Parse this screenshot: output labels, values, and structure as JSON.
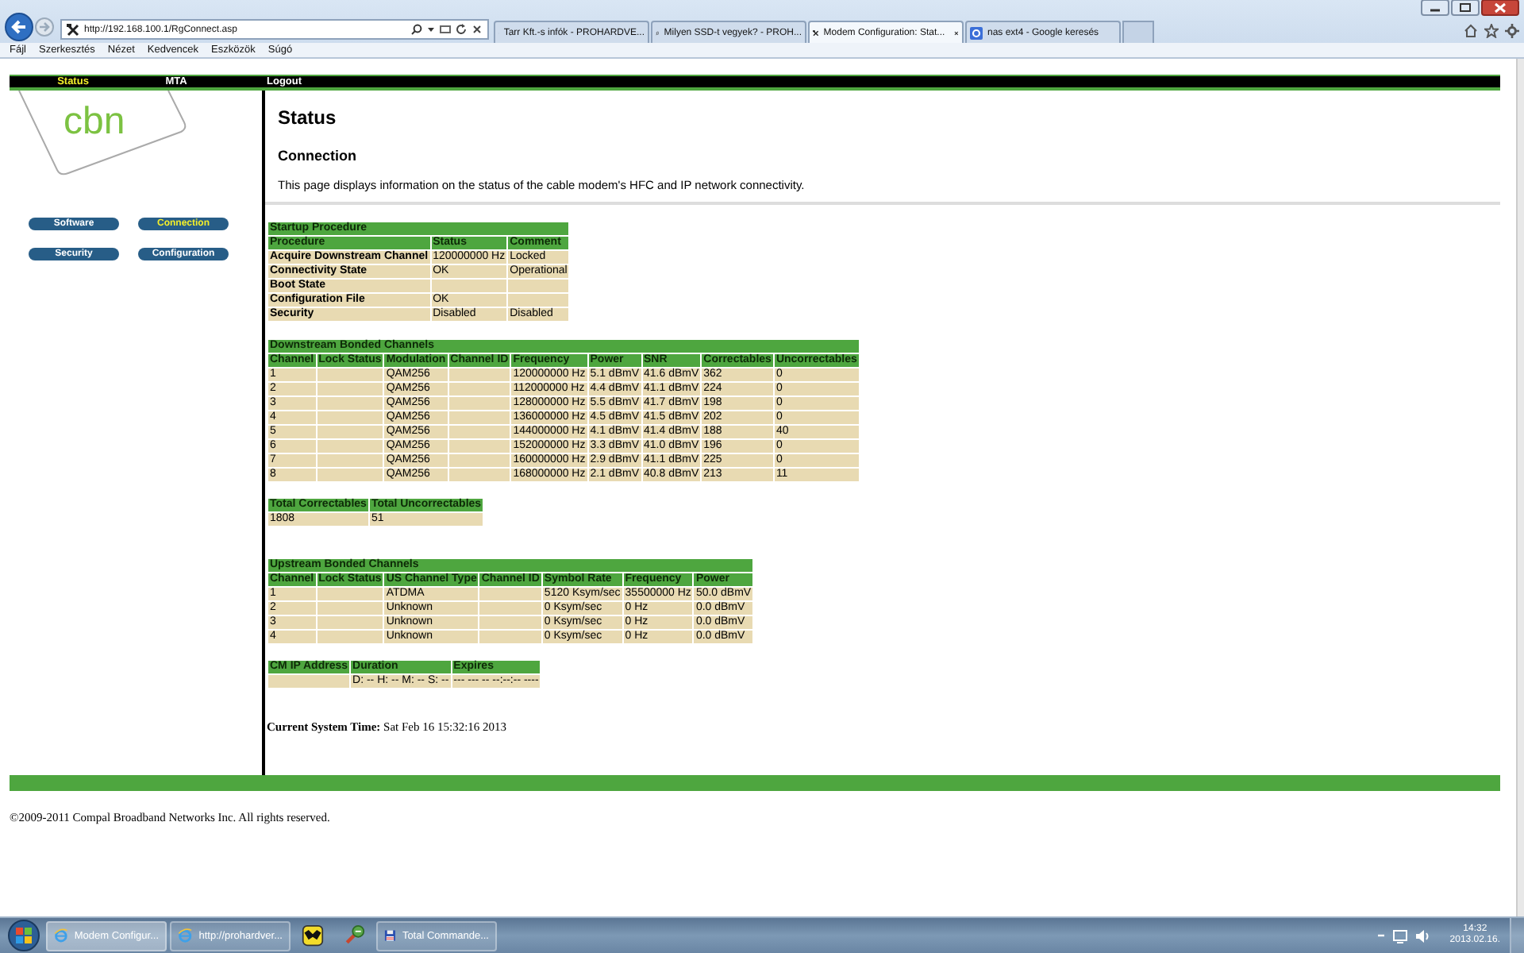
{
  "browser": {
    "address": "http://192.168.100.1/RgConnect.asp",
    "tabs": [
      {
        "label": "Tarr Kft.-s infók - PROHARDVE...",
        "kind": "site",
        "selected": false
      },
      {
        "label": "Milyen SSD-t vegyek? - PROH...",
        "kind": "site",
        "selected": false
      },
      {
        "label": "Modem Configuration: Stat...",
        "kind": "tools",
        "selected": true
      },
      {
        "label": "nas ext4 - Google keresés",
        "kind": "google",
        "selected": false
      }
    ],
    "menu": [
      "Fájl",
      "Szerkesztés",
      "Nézet",
      "Kedvencek",
      "Eszközök",
      "Súgó"
    ]
  },
  "top_nav": [
    {
      "label": "Status",
      "selected": true
    },
    {
      "label": "MTA",
      "selected": false
    },
    {
      "label": "Logout",
      "selected": false
    }
  ],
  "logo": "cbn",
  "side_buttons": [
    {
      "label": "Software",
      "selected": false
    },
    {
      "label": "Connection",
      "selected": true
    },
    {
      "label": "Security",
      "selected": false
    },
    {
      "label": "Configuration",
      "selected": false
    }
  ],
  "page": {
    "title": "Status",
    "subtitle": "Connection",
    "description": "This page displays information on the status of the cable modem's HFC and IP network connectivity."
  },
  "tables": [
    {
      "title": "Startup Procedure",
      "first_column_is_header": true,
      "columns": [
        "Procedure",
        "Status",
        "Comment"
      ],
      "rows": [
        [
          "Acquire Downstream Channel",
          "120000000 Hz",
          "Locked"
        ],
        [
          "Connectivity State",
          "OK",
          "Operational"
        ],
        [
          "Boot State",
          null,
          null
        ],
        [
          "Configuration File",
          "OK",
          null
        ],
        [
          "Security",
          "Disabled",
          "Disabled"
        ]
      ]
    },
    {
      "title": "Downstream Bonded Channels",
      "columns": [
        "Channel",
        "Lock Status",
        "Modulation",
        "Channel ID",
        "Frequency",
        "Power",
        "SNR",
        "Correctables",
        "Uncorrectables"
      ],
      "rows": [
        [
          "1",
          null,
          "QAM256",
          null,
          "120000000 Hz",
          "5.1 dBmV",
          "41.6 dBmV",
          "362",
          "0"
        ],
        [
          "2",
          null,
          "QAM256",
          null,
          "112000000 Hz",
          "4.4 dBmV",
          "41.1 dBmV",
          "224",
          "0"
        ],
        [
          "3",
          null,
          "QAM256",
          null,
          "128000000 Hz",
          "5.5 dBmV",
          "41.7 dBmV",
          "198",
          "0"
        ],
        [
          "4",
          null,
          "QAM256",
          null,
          "136000000 Hz",
          "4.5 dBmV",
          "41.5 dBmV",
          "202",
          "0"
        ],
        [
          "5",
          null,
          "QAM256",
          null,
          "144000000 Hz",
          "4.1 dBmV",
          "41.4 dBmV",
          "188",
          "40"
        ],
        [
          "6",
          null,
          "QAM256",
          null,
          "152000000 Hz",
          "3.3 dBmV",
          "41.0 dBmV",
          "196",
          "0"
        ],
        [
          "7",
          null,
          "QAM256",
          null,
          "160000000 Hz",
          "2.9 dBmV",
          "41.1 dBmV",
          "225",
          "0"
        ],
        [
          "8",
          null,
          "QAM256",
          null,
          "168000000 Hz",
          "2.1 dBmV",
          "40.8 dBmV",
          "213",
          "11"
        ]
      ]
    },
    {
      "columns": [
        "Total Correctables",
        "Total Uncorrectables"
      ],
      "rows": [
        [
          "1808",
          "51"
        ]
      ]
    },
    {
      "title": "Upstream Bonded Channels",
      "columns": [
        "Channel",
        "Lock Status",
        "US Channel Type",
        "Channel ID",
        "Symbol Rate",
        "Frequency",
        "Power"
      ],
      "rows": [
        [
          "1",
          null,
          "ATDMA",
          null,
          "5120 Ksym/sec",
          "35500000 Hz",
          "50.0 dBmV"
        ],
        [
          "2",
          null,
          "Unknown",
          null,
          "0 Ksym/sec",
          "0 Hz",
          "0.0 dBmV"
        ],
        [
          "3",
          null,
          "Unknown",
          null,
          "0 Ksym/sec",
          "0 Hz",
          "0.0 dBmV"
        ],
        [
          "4",
          null,
          "Unknown",
          null,
          "0 Ksym/sec",
          "0 Hz",
          "0.0 dBmV"
        ]
      ]
    },
    {
      "columns": [
        "CM IP Address",
        "Duration",
        "Expires"
      ],
      "rows": [
        [
          null,
          "D: -- H: -- M: -- S: --",
          "--- --- -- --:--:-- ----"
        ]
      ]
    }
  ],
  "system_time": {
    "label": "Current System Time:",
    "value": "Sat Feb 16 15:32:16 2013"
  },
  "copyright": "©2009-2011 Compal Broadband Networks Inc. All rights reserved.",
  "taskbar": {
    "items": [
      {
        "label": "Modem Configur...",
        "kind": "ie",
        "selected": true
      },
      {
        "label": "http://prohardver...",
        "kind": "ie",
        "selected": false
      },
      {
        "kind": "bat",
        "selected": false
      },
      {
        "kind": "tool",
        "selected": false
      },
      {
        "label": "Total Commande...",
        "kind": "floppy",
        "selected": false
      }
    ],
    "time": "14:32",
    "date": "2013.02.16."
  }
}
